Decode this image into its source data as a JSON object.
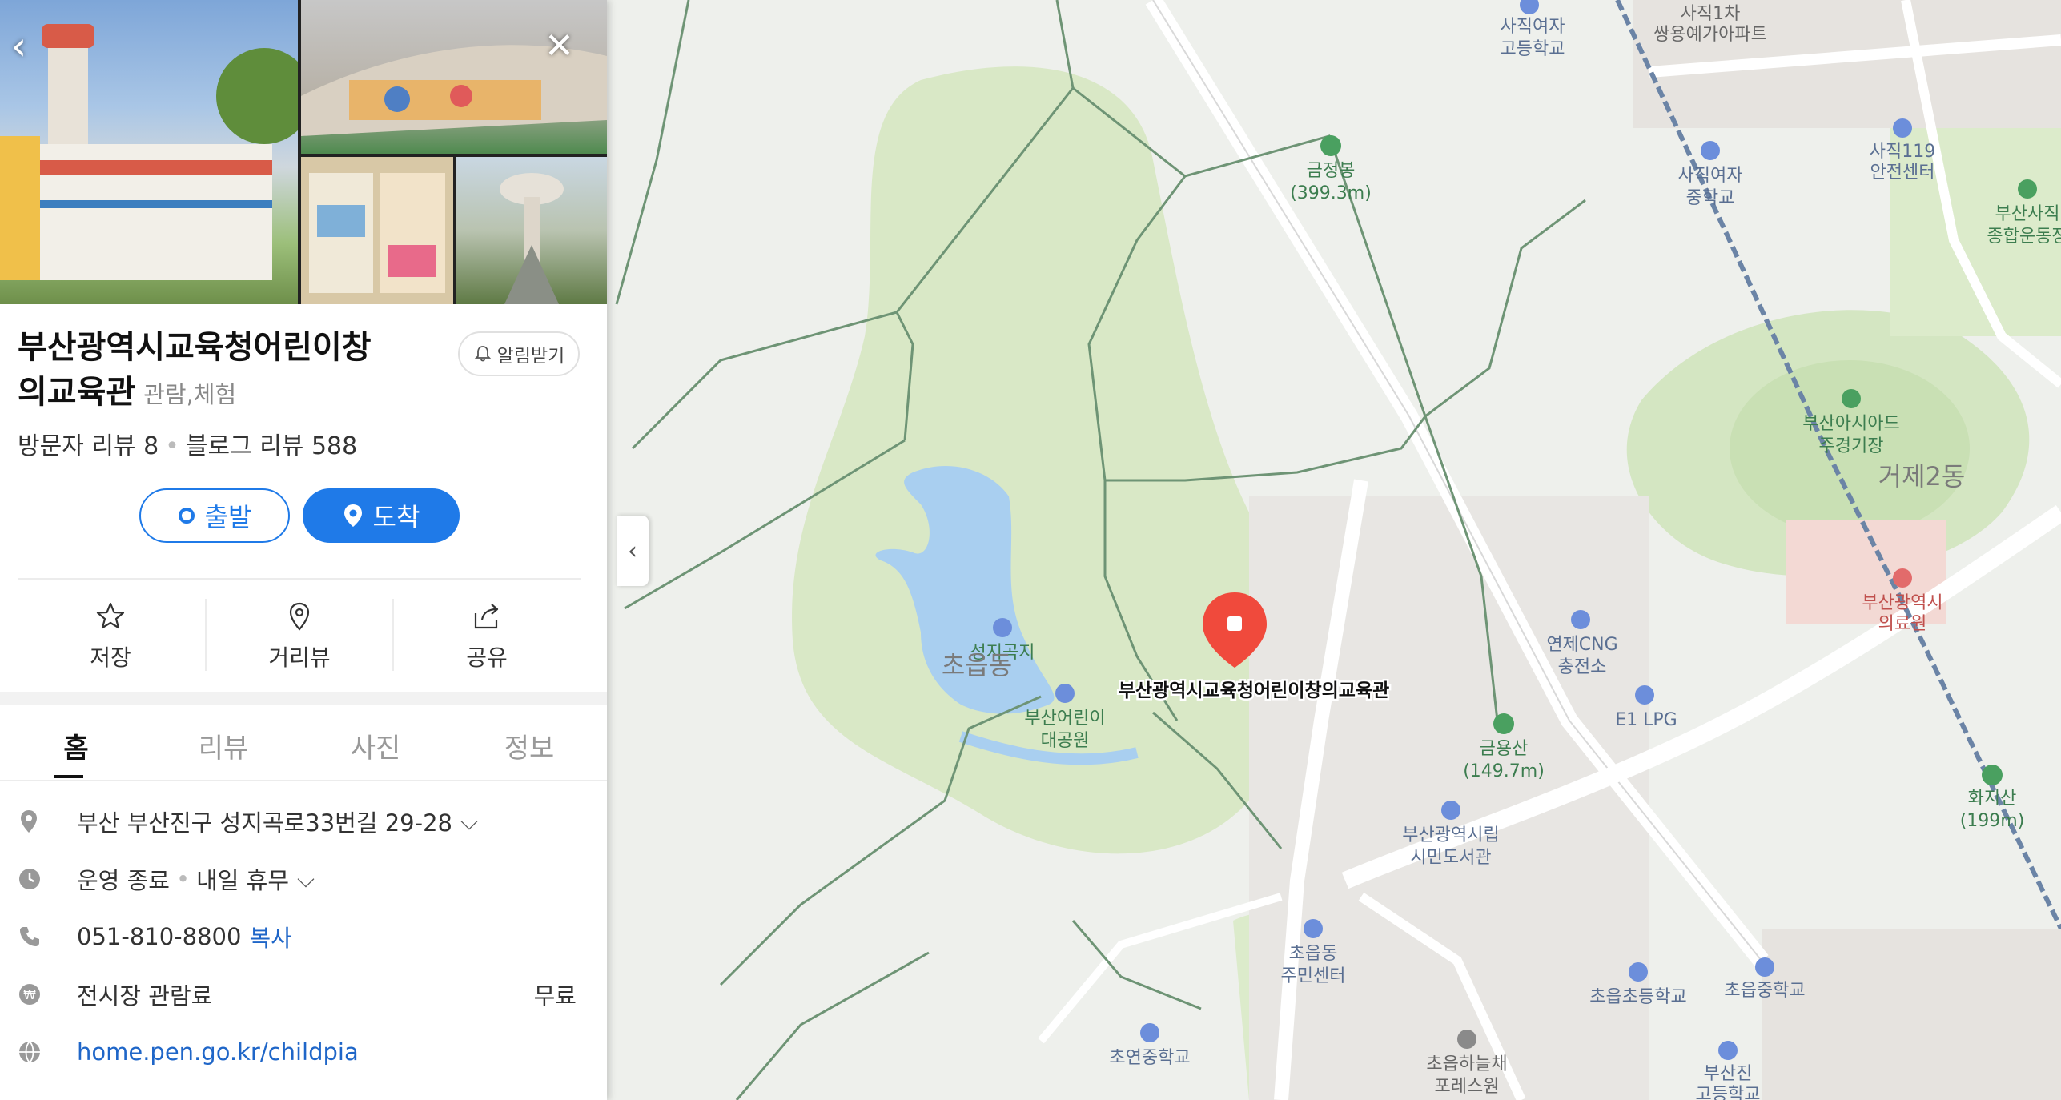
{
  "place": {
    "title_line1": "부산광역시교육청어린이창",
    "title_line2": "의교육관",
    "category": "관람,체험",
    "alarm_label": "알림받기",
    "visitor_reviews": "방문자 리뷰 8",
    "blog_reviews": "블로그 리뷰 588"
  },
  "directions": {
    "start_label": "출발",
    "arrive_label": "도착"
  },
  "actions": [
    {
      "label": "저장",
      "icon": "star-icon"
    },
    {
      "label": "거리뷰",
      "icon": "streetview-pin-icon"
    },
    {
      "label": "공유",
      "icon": "share-icon"
    }
  ],
  "tabs": [
    {
      "label": "홈",
      "active": true
    },
    {
      "label": "리뷰",
      "active": false
    },
    {
      "label": "사진",
      "active": false
    },
    {
      "label": "정보",
      "active": false
    }
  ],
  "info": {
    "address": "부산 부산진구 성지곡로33번길 29-28",
    "hours_status": "운영 종료",
    "hours_next": "내일 휴무",
    "phone": "051-810-8800",
    "copy_label": "복사",
    "fee_label": "전시장 관람료",
    "fee_value": "무료",
    "website": "home.pen.go.kr/childpia"
  },
  "map": {
    "marker_label": "부산광역시교육청어린이창의교육관",
    "accent_color": "#f04a3c",
    "labels": {
      "l1": "사직여자",
      "l1b": "고등학교",
      "l2": "사직1차",
      "l2b": "쌍용예가아파트",
      "l3": "금정봉",
      "l3b": "(399.3m)",
      "l4": "사직여자",
      "l4b": "중학교",
      "l5": "사직119",
      "l5b": "안전센터",
      "l6": "부산사직",
      "l6b": "종합운동장",
      "l7": "부산아시아드",
      "l7b": "주경기장",
      "l8": "거제2동",
      "l9": "부산광역시",
      "l9b": "의료원",
      "l10": "연제CNG",
      "l10b": "충전소",
      "l11": "E1 LPG",
      "l12": "금용산",
      "l12b": "(149.7m)",
      "l13": "화지산",
      "l13b": "(199m)",
      "l14": "성지곡지",
      "l15": "초읍동",
      "l16": "부산어린이",
      "l16b": "대공원",
      "l17": "부산광역시립",
      "l17b": "시민도서관",
      "l18": "초읍동",
      "l18b": "주민센터",
      "l19": "초읍초등학교",
      "l20": "초읍중학교",
      "l21": "초연중학교",
      "l22": "초읍하늘채",
      "l22b": "포레스원",
      "l23": "부산진",
      "l23b": "고등학교"
    }
  }
}
